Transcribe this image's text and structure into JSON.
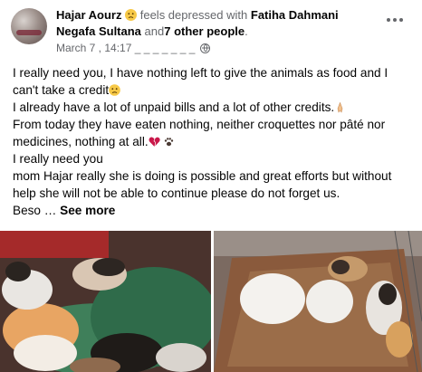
{
  "post": {
    "author": "Hajar Aourz",
    "feeling": "feels depressed with",
    "tagged": "Fatiha Dahmani Negafa Sultana",
    "and_text": "and",
    "others": "7 other people",
    "timestamp": "March 7 , 14:17 _ _ _ _ _ _ _",
    "more_label": "More options",
    "paragraphs": [
      "I really need you, I have nothing left to give the animals as food and I can't take a credit",
      "I already have a lot of unpaid bills and a lot of other credits.",
      "From today they have eaten nothing, neither croquettes nor pâté nor medicines, nothing at all.",
      "I really need you",
      "mom Hajar really she is doing is possible and great efforts but without help she will not be able to continue please do not forget us."
    ],
    "last_line": "Beso …",
    "see_more": "See more"
  },
  "icons": {
    "feeling": "disappointed-face-icon",
    "privacy": "globe-icon",
    "more": "ellipsis-icon"
  },
  "colors": {
    "text": "#050505",
    "secondary_text": "#65676b",
    "emoji_yellow": "#f7c948",
    "heart_red": "#c9184a"
  }
}
